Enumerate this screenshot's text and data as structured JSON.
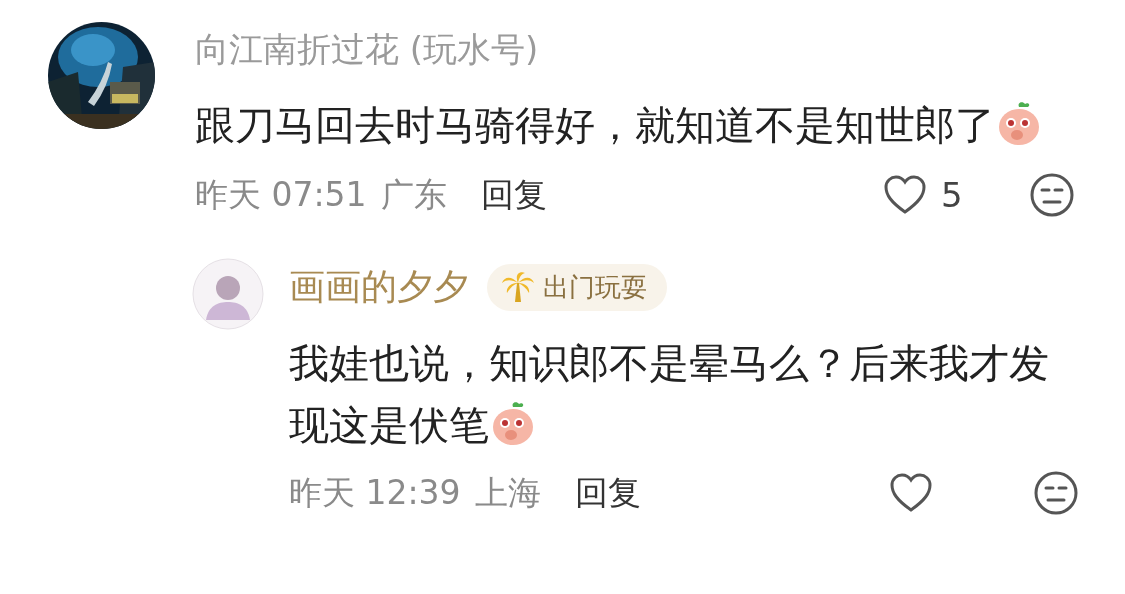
{
  "comments": [
    {
      "kind": "comment",
      "username": "向江南折过花 (玩水号)",
      "text": "跟刀马回去时马骑得好，就知道不是知世郎了",
      "time": "昨天 07:51",
      "location": "广东",
      "reply_label": "回复",
      "like_count": "5"
    },
    {
      "kind": "reply",
      "avatar": {
        "kind": "silhouette"
      },
      "username": "画画的夕夕",
      "badge": "出门玩耍",
      "text": "我娃也说，知识郎不是晕马么？后来我才发现这是伏笔",
      "time": "昨天 12:39",
      "location": "上海",
      "reply_label": "回复"
    }
  ]
}
